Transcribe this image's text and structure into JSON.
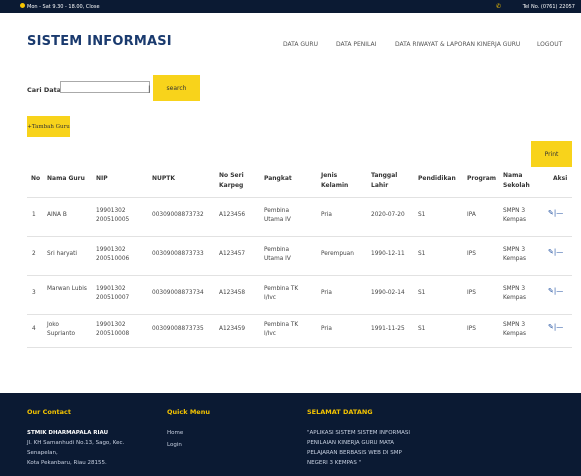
{
  "topbar": {
    "hours": "Mon - Sat 9.30 - 18.00, Close",
    "phone": "Tel No. (0761) 22057"
  },
  "header": {
    "brand": "SISTEM INFORMASI",
    "nav": [
      "DATA GURU",
      "DATA PENILAI",
      "DATA RIWAYAT & LAPORAN KINERJA GURU",
      "LOGOUT"
    ]
  },
  "search": {
    "label": "Cari Data",
    "value": "",
    "pipe": "|",
    "button": "search"
  },
  "add_button": "+Tambah Guru",
  "print_button": "Print",
  "table": {
    "headers": [
      "No",
      "Nama Guru",
      "NIP",
      "NUPTK",
      "No Seri Karpeg",
      "Pangkat",
      "Jenis Kelamin",
      "Tanggal Lahir",
      "Pendidikan",
      "Program",
      "Nama Sekolah",
      "Aksi"
    ],
    "rows": [
      [
        "1",
        "AINA B",
        "19901302 200510005",
        "00309008873732",
        "A123456",
        "Pembina Utama IV",
        "Pria",
        "2020-07-20",
        "S1",
        "IPA",
        "SMPN 3 Kempas"
      ],
      [
        "2",
        "Sri haryati",
        "19901302 200510006",
        "00309008873733",
        "A123457",
        "Pembina Utama IV",
        "Perempuan",
        "1990-12-11",
        "S1",
        "IPS",
        "SMPN 3 Kempas"
      ],
      [
        "3",
        "Marwan Lubis",
        "19901302 200510007",
        "00309008873734",
        "A123458",
        "Pembina TK I/Ivc",
        "Pria",
        "1990-02-14",
        "S1",
        "IPS",
        "SMPN 3 Kempas"
      ],
      [
        "4",
        "Joko Suprianto",
        "19901302 200510008",
        "00309008873735",
        "A123459",
        "Pembina TK I/Ivc",
        "Pria",
        "1991-11-25",
        "S1",
        "IPS",
        "SMPN 3 Kempas"
      ]
    ],
    "action_separator": "|"
  },
  "footer": {
    "contact_title": "Our Contact",
    "org": "STMIK DHARMAPALA RIAU",
    "address1": "Jl. KH Samanhudi No.13, Sago, Kec.",
    "address2": "Senapelan,",
    "address3": "Kota Pekanbaru, Riau 28155.",
    "quick_title": "Quick Menu",
    "quick_items": [
      "Home",
      "Login"
    ],
    "welcome_title": "SELAMAT DATANG",
    "welcome_lines": [
      "\"APLIKASI SISTEM SISTEM INFORMASI",
      "PENILAIAN KINERJA GURU MATA",
      "PELAJARAN BERBASIS WEB DI SMP",
      "NEGERI 3 KEMPAS \""
    ]
  },
  "colors": {
    "navy": "#0b1a33",
    "accent_yellow": "#f8d31b",
    "brand_blue": "#1a3a6e"
  },
  "icons": {
    "edit": "pencil-icon",
    "delete": "minus-icon",
    "clock": "clock-icon",
    "phone": "phone-icon"
  }
}
